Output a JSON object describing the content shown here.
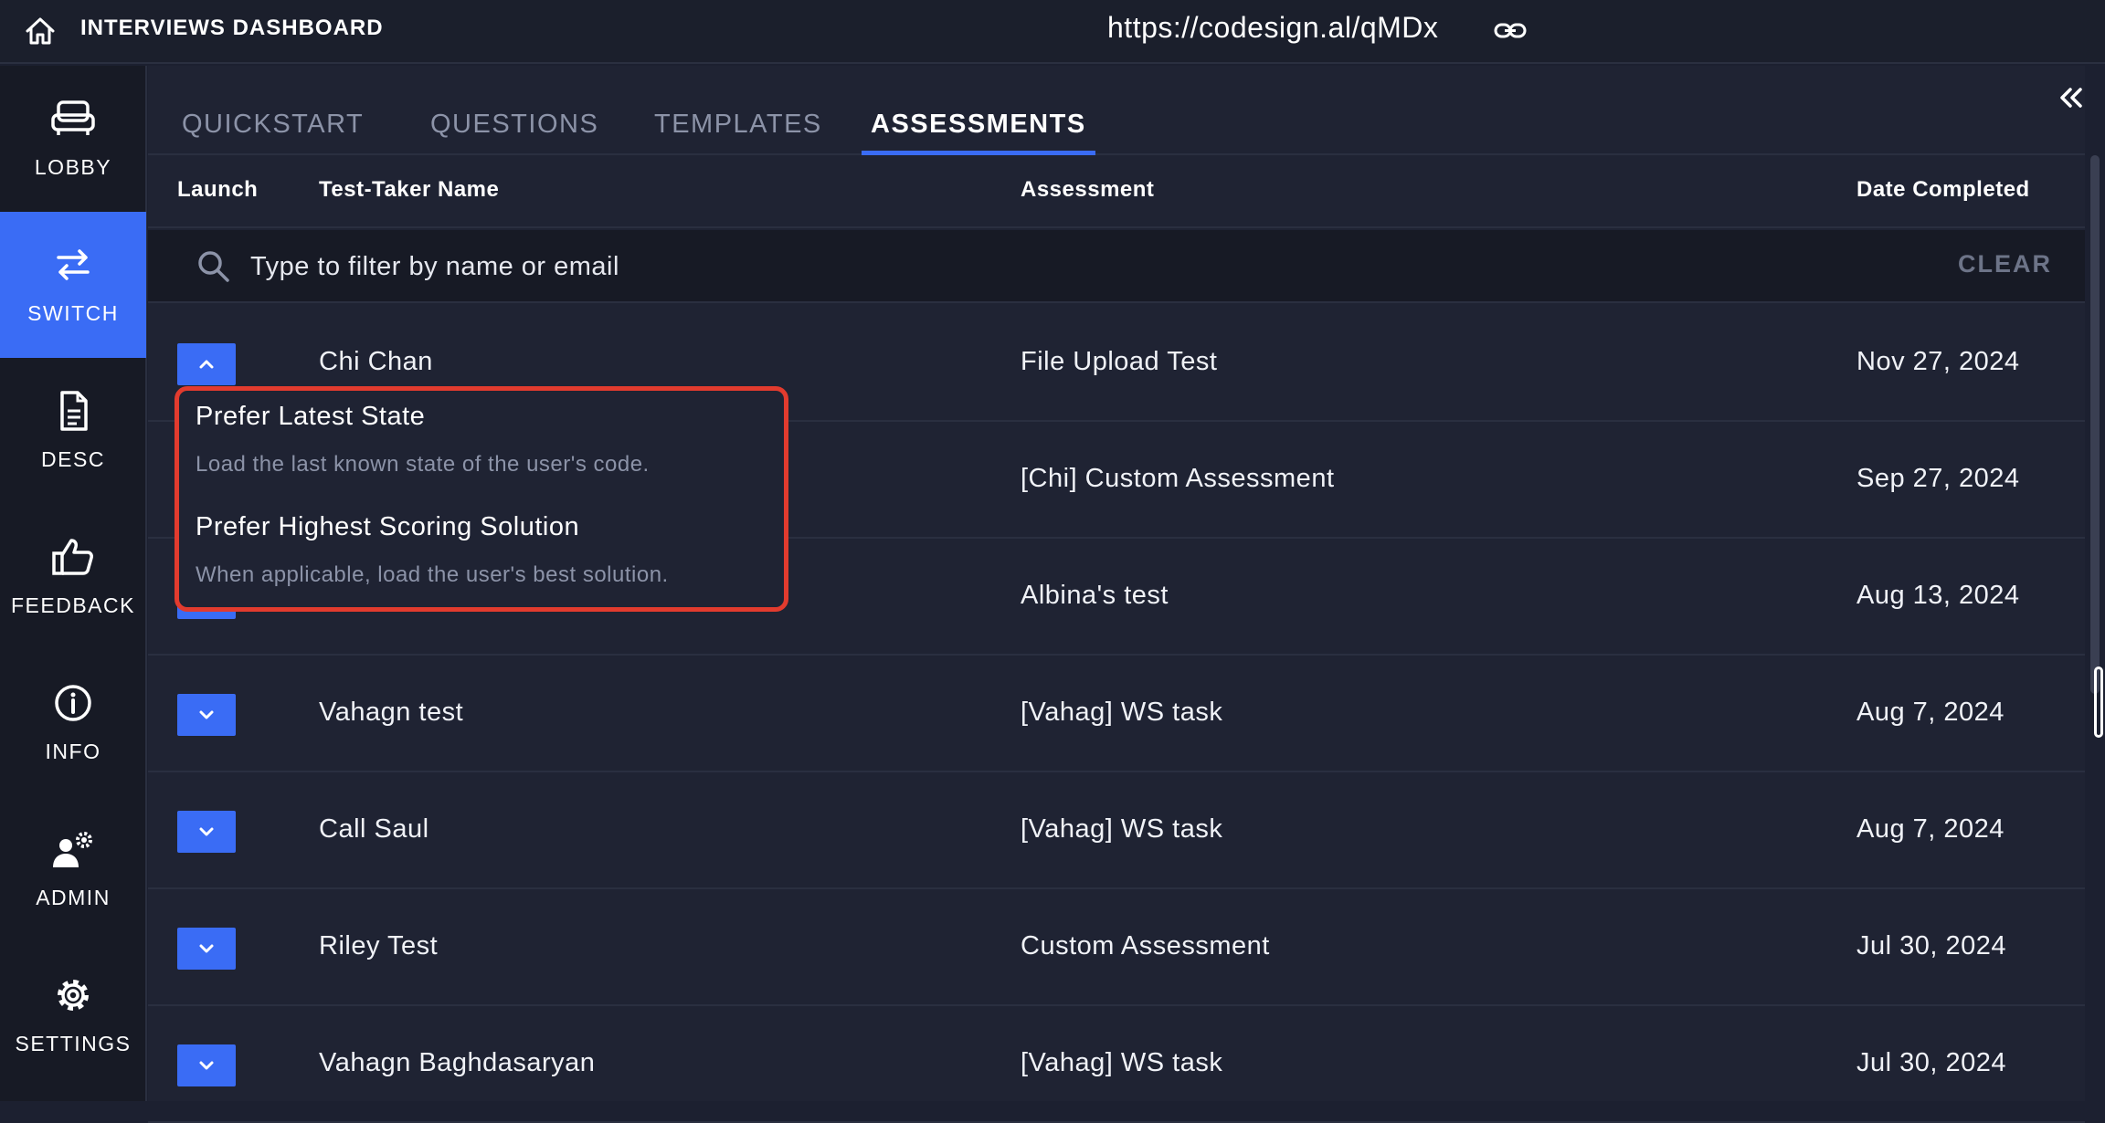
{
  "topbar": {
    "home_icon": "home-icon",
    "title": "INTERVIEWS DASHBOARD",
    "url": "https://codesign.al/qMDx",
    "link_icon": "link-icon"
  },
  "sidebar": {
    "items": [
      {
        "label": "LOBBY",
        "icon": "sofa-icon",
        "active": false
      },
      {
        "label": "SWITCH",
        "icon": "switch-arrows-icon",
        "active": true
      },
      {
        "label": "DESC",
        "icon": "document-icon",
        "active": false
      },
      {
        "label": "FEEDBACK",
        "icon": "thumbs-up-icon",
        "active": false
      },
      {
        "label": "INFO",
        "icon": "info-icon",
        "active": false
      },
      {
        "label": "ADMIN",
        "icon": "user-gear-icon",
        "active": false
      },
      {
        "label": "SETTINGS",
        "icon": "gear-icon",
        "active": false
      }
    ]
  },
  "tabs": [
    {
      "label": "QUICKSTART",
      "active": false
    },
    {
      "label": "QUESTIONS",
      "active": false
    },
    {
      "label": "TEMPLATES",
      "active": false
    },
    {
      "label": "ASSESSMENTS",
      "active": true
    }
  ],
  "table": {
    "headers": {
      "launch": "Launch",
      "name": "Test-Taker Name",
      "assessment": "Assessment",
      "date": "Date Completed"
    },
    "filter": {
      "placeholder": "Type to filter by name or email",
      "clear_label": "CLEAR"
    },
    "rows": [
      {
        "name": "Chi Chan",
        "assessment": "File Upload Test",
        "date": "Nov 27, 2024",
        "expanded": true
      },
      {
        "name": "",
        "assessment": "[Chi] Custom Assessment",
        "date": "Sep 27, 2024",
        "expanded": false
      },
      {
        "name": "",
        "assessment": "Albina's test",
        "date": "Aug 13, 2024",
        "expanded": false
      },
      {
        "name": "Vahagn test",
        "assessment": "[Vahag] WS task",
        "date": "Aug 7, 2024",
        "expanded": false
      },
      {
        "name": "Call Saul",
        "assessment": "[Vahag] WS task",
        "date": "Aug 7, 2024",
        "expanded": false
      },
      {
        "name": "Riley Test",
        "assessment": "Custom Assessment",
        "date": "Jul 30, 2024",
        "expanded": false
      },
      {
        "name": "Vahagn Baghdasaryan",
        "assessment": "[Vahag] WS task",
        "date": "Jul 30, 2024",
        "expanded": false
      }
    ]
  },
  "launch_menu": {
    "options": [
      {
        "title": "Prefer Latest State",
        "description": "Load the last known state of the user's code."
      },
      {
        "title": "Prefer Highest Scoring Solution",
        "description": "When applicable, load the user's best solution."
      }
    ]
  },
  "colors": {
    "accent": "#3a6cf5",
    "highlight_border": "#e23b2e",
    "background": "#1f2333"
  }
}
